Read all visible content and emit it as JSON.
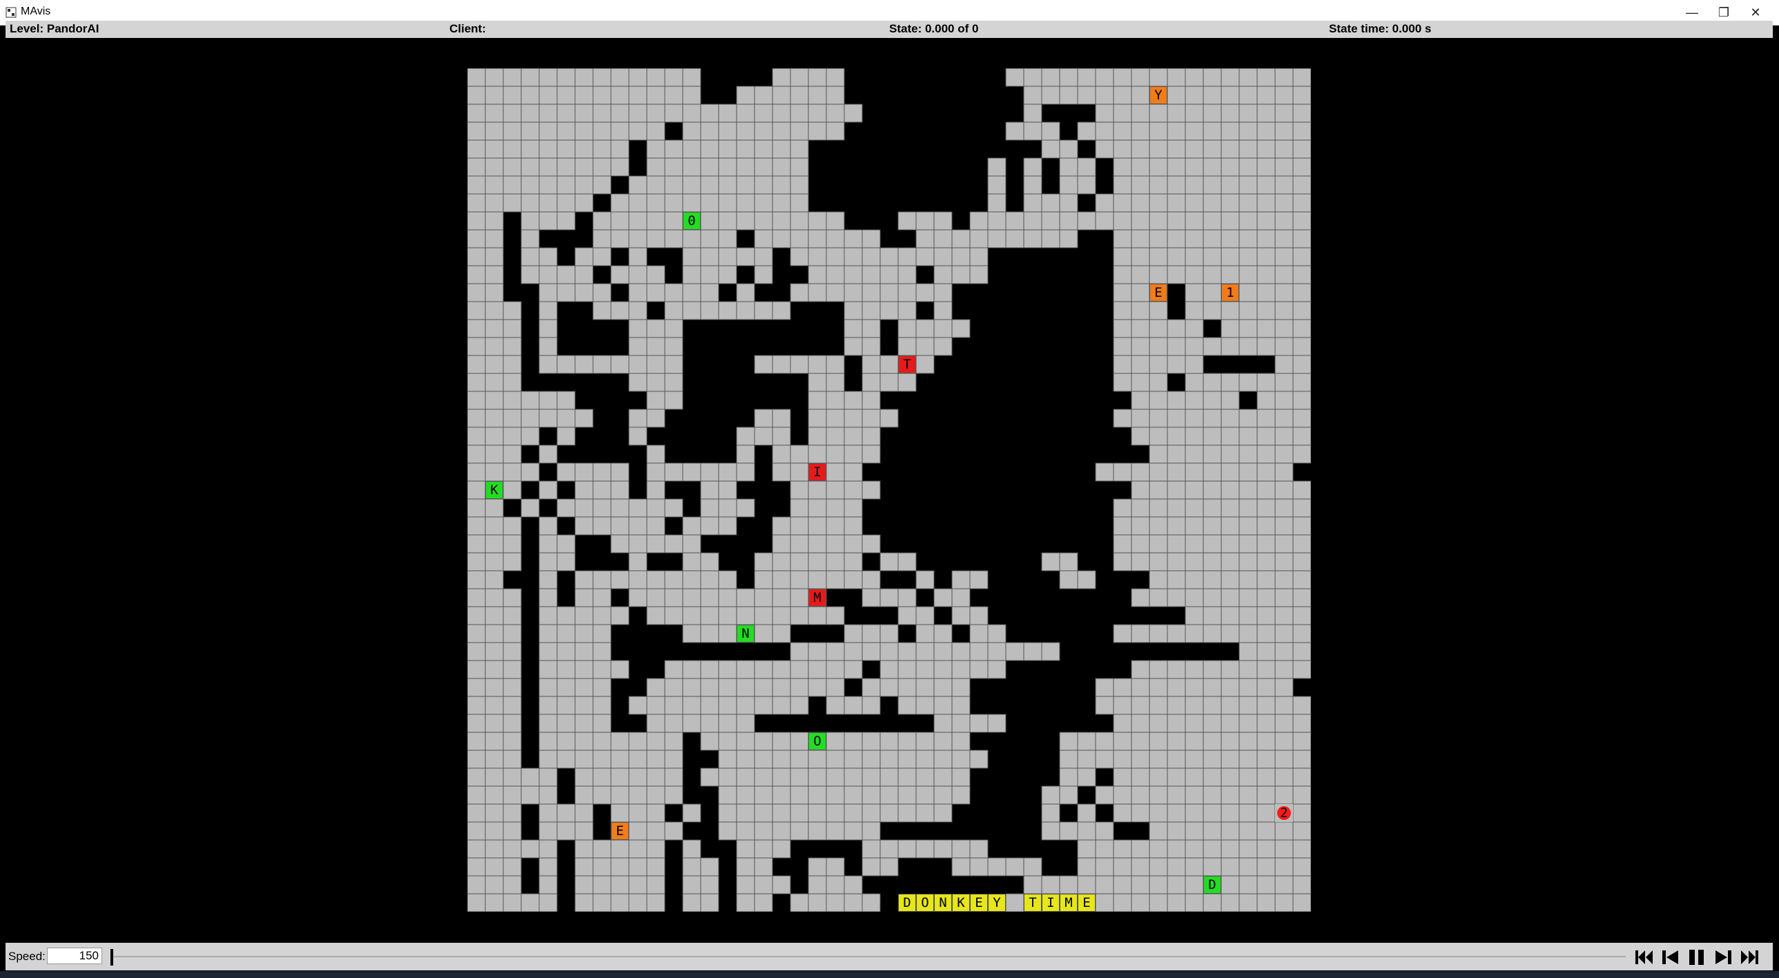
{
  "window": {
    "title": "MAvis"
  },
  "status": {
    "level": "Level: PandorAI",
    "client": "Client:",
    "state": "State: 0.000 of 0",
    "state_time": "State time: 0.000 s"
  },
  "controls": {
    "speed_label": "Speed:",
    "speed_value": "150",
    "progress": 0
  },
  "grid": {
    "cols": 47,
    "rows": 47,
    "colors": {
      "wall": "#000000",
      "floor": "#bdbdbd",
      "agent": "#ff1a1a",
      "box_green": "#22dd22",
      "box_orange": "#f07c1a",
      "box_red": "#e51b1b",
      "goal_yellow": "#e6e619"
    },
    "rows_map": [
      "+++++++++++++....++++.........++++++++++++++++++",
      "+++++++++++++..++++++..........++++++++++++++++",
      "++++++++++++++++++++++.........+...++++++++++++",
      "+++++++++++.+++++++++.........+++.+++++++++++++",
      "+++++++++.+++++++++.............++.+++++++++++++",
      "+++++++++.+++++++++..........+.+.++.+++++++++++++",
      "++++++++.++++++++++..........+.+.++.+++++++++++++",
      "+++++++.+++++++++++..........+.+++.+++++++++++++",
      "++.+++.++++++++++++++...+++.+++++++++++++++++++++",
      "++.+...++++++++.+++++++..+++++++++..++++++++++++",
      "++.++.++.+..+++++.+++++++++++.......+++++++++++++",
      "++.++++.+++.+++.+..++++++.+++.......++++++++++++",
      "++..++++.+++++.+..+++++++++.........+++.++++++++",
      "+++.+..+++.+++++++...++++.+.........+++.++++++++",
      "+++.+....+++.........++.++++........+++++.+++++",
      "+++.+....+++.........++.+++.........++++++++++++",
      "+++.++++++++....+++++.++++..........+++++....+++",
      "+++......+++.......++.+++...........+++.+++++++",
      "++++++....++.......++++..............++++++.++++",
      "+++++++..++.....++.+++++............+++++++++++",
      "++++.+...+.....+++.++++..............+++++++++++",
      "+++.+.....+....+.++++++...............++++++++++",
      "++++.++++.++++++.+++++.............+++++++++++",
      "+++.+.+++.+..++...+++++..............+++++++++++",
      "++.+.+++++++.+++..++++..............+++++++++++",
      "+++.+.+++++.+++..+++++..............+++++++++++",
      "+++.++..+++++....++++++.............+++++++++++",
      "+++.++...+..++..++++++.++.......++..+++++++++++",
      "++..+.+++++++++.+++++++..+.++....++...+++++++++++",
      "+++.+.++.+++++++++++..+++.++.........+++++++++++",
      "+++.+++++.+++++++++++...++.++...........+++++++++",
      "+++.++++....++++++...+++.++.++......+++++++++++",
      "+++.++++..........+++++++++++++++..........++++++",
      "+++.+++++..+++++++++++.+++++++.......+++++++++++",
      "+++.++++..+++++++++++.++++++.......+++++++++++",
      "+++.++++.++++++++++.+++.++++.......++++++++++++",
      "+++.++++..++++++..........++++......++++++++++++",
      "+++.++++++++.+++++++++++++++.....+++++++++++++++",
      "+++.++++++++..+++++++++++++++....+++++++++++++++",
      "+++++.++++++.+++++++++++++++.....++.++++++++++++",
      "+++++.++++++..++++++++++++++....++.++++++++++++",
      "+++.+++.+++.+.+++++++++++++.....+.+.+++++++++++++",
      "+++.+++.++++..+++++++++.........++++..++++++++++",
      "+++++.+++++.+..+++....+++++++.....+++++++++++++",
      "+++.+.+++++.++.++..++.++...+++++..+++++++++++++",
      "+++.+.+++++.++.+++.+++.........+++++++++++++++++",
      "+++++.+++++.++.++.+++++.......+++++++++++++++++++"
    ],
    "items": [
      {
        "r": 1,
        "c": 38,
        "label": "Y",
        "kind": "box_orange"
      },
      {
        "r": 8,
        "c": 12,
        "label": "0",
        "kind": "box_green"
      },
      {
        "r": 12,
        "c": 38,
        "label": "E",
        "kind": "box_orange"
      },
      {
        "r": 12,
        "c": 42,
        "label": "1",
        "kind": "box_orange"
      },
      {
        "r": 16,
        "c": 24,
        "label": "T",
        "kind": "box_red"
      },
      {
        "r": 22,
        "c": 19,
        "label": "I",
        "kind": "box_red"
      },
      {
        "r": 23,
        "c": 1,
        "label": "K",
        "kind": "box_green"
      },
      {
        "r": 29,
        "c": 19,
        "label": "M",
        "kind": "box_red"
      },
      {
        "r": 31,
        "c": 15,
        "label": "N",
        "kind": "box_green"
      },
      {
        "r": 37,
        "c": 19,
        "label": "O",
        "kind": "box_green"
      },
      {
        "r": 41,
        "c": 45,
        "label": "2",
        "kind": "agent"
      },
      {
        "r": 42,
        "c": 8,
        "label": "E",
        "kind": "box_orange"
      },
      {
        "r": 45,
        "c": 41,
        "label": "D",
        "kind": "box_green"
      },
      {
        "r": 46,
        "c": 24,
        "label": "D",
        "kind": "goal_yellow"
      },
      {
        "r": 46,
        "c": 25,
        "label": "O",
        "kind": "goal_yellow"
      },
      {
        "r": 46,
        "c": 26,
        "label": "N",
        "kind": "goal_yellow"
      },
      {
        "r": 46,
        "c": 27,
        "label": "K",
        "kind": "goal_yellow"
      },
      {
        "r": 46,
        "c": 28,
        "label": "E",
        "kind": "goal_yellow"
      },
      {
        "r": 46,
        "c": 29,
        "label": "Y",
        "kind": "goal_yellow"
      },
      {
        "r": 46,
        "c": 31,
        "label": "T",
        "kind": "goal_yellow"
      },
      {
        "r": 46,
        "c": 32,
        "label": "I",
        "kind": "goal_yellow"
      },
      {
        "r": 46,
        "c": 33,
        "label": "M",
        "kind": "goal_yellow"
      },
      {
        "r": 46,
        "c": 34,
        "label": "E",
        "kind": "goal_yellow"
      }
    ]
  }
}
